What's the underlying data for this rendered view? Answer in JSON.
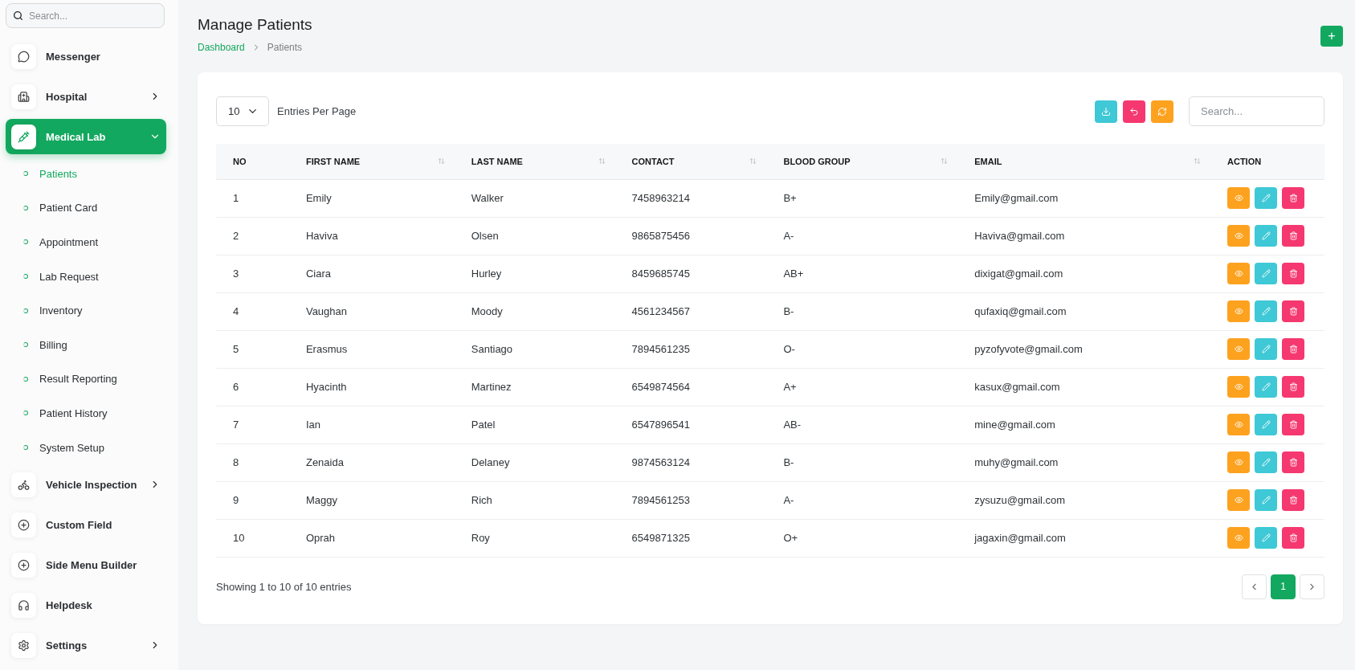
{
  "sidebar": {
    "search": {
      "placeholder": "Search..."
    },
    "items": [
      {
        "label": "Messenger",
        "selected": false
      },
      {
        "label": "Hospital",
        "selected": false,
        "expanded": false
      },
      {
        "label": "Medical Lab",
        "selected": true,
        "expanded": true,
        "children": [
          {
            "label": "Patients",
            "selected": true
          },
          {
            "label": "Patient Card",
            "selected": false
          },
          {
            "label": "Appointment",
            "selected": false
          },
          {
            "label": "Lab Request",
            "selected": false
          },
          {
            "label": "Inventory",
            "selected": false
          },
          {
            "label": "Billing",
            "selected": false
          },
          {
            "label": "Result Reporting",
            "selected": false
          },
          {
            "label": "Patient History",
            "selected": false
          },
          {
            "label": "System Setup",
            "selected": false
          }
        ]
      },
      {
        "label": "Vehicle Inspection",
        "selected": false,
        "expanded": false
      },
      {
        "label": "Custom Field",
        "selected": false
      },
      {
        "label": "Side Menu Builder",
        "selected": false
      },
      {
        "label": "Helpdesk",
        "selected": false
      },
      {
        "label": "Settings",
        "selected": false,
        "expanded": false
      }
    ]
  },
  "header": {
    "title": "Manage Patients",
    "breadcrumb": [
      "Dashboard",
      "Patients"
    ],
    "add_button": "+"
  },
  "toolbar": {
    "entries": "10",
    "entries_label": "Entries Per Page",
    "search": {
      "placeholder": "Search..."
    }
  },
  "table": {
    "columns": [
      {
        "label": "NO",
        "sortable": false
      },
      {
        "label": "FIRST NAME",
        "sortable": true
      },
      {
        "label": "LAST NAME",
        "sortable": true
      },
      {
        "label": "CONTACT",
        "sortable": true
      },
      {
        "label": "BLOOD GROUP",
        "sortable": true
      },
      {
        "label": "EMAIL",
        "sortable": true
      },
      {
        "label": "ACTION",
        "sortable": false
      }
    ],
    "rows": [
      [
        "1",
        "Emily",
        "Walker",
        "7458963214",
        "B+",
        "Emily@gmail.com"
      ],
      [
        "2",
        "Haviva",
        "Olsen",
        "9865875456",
        "A-",
        "Haviva@gmail.com"
      ],
      [
        "3",
        "Ciara",
        "Hurley",
        "8459685745",
        "AB+",
        "dixigat@gmail.com"
      ],
      [
        "4",
        "Vaughan",
        "Moody",
        "4561234567",
        "B-",
        "qufaxiq@gmail.com"
      ],
      [
        "5",
        "Erasmus",
        "Santiago",
        "7894561235",
        "O-",
        "pyzofyvote@gmail.com"
      ],
      [
        "6",
        "Hyacinth",
        "Martinez",
        "6549874564",
        "A+",
        "kasux@gmail.com"
      ],
      [
        "7",
        "Ian",
        "Patel",
        "6547896541",
        "AB-",
        "mine@gmail.com"
      ],
      [
        "8",
        "Zenaida",
        "Delaney",
        "9874563124",
        "B-",
        "muhy@gmail.com"
      ],
      [
        "9",
        "Maggy",
        "Rich",
        "7894561253",
        "A-",
        "zysuzu@gmail.com"
      ],
      [
        "10",
        "Oprah",
        "Roy",
        "6549871325",
        "O+",
        "jagaxin@gmail.com"
      ]
    ]
  },
  "footer": {
    "info": "Showing 1 to 10 of 10 entries",
    "pages": [
      {
        "label": "1",
        "selected": true
      }
    ]
  }
}
